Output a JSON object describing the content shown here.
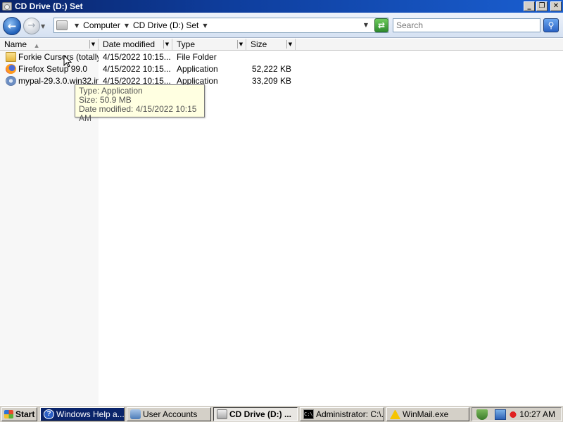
{
  "window": {
    "title": "CD Drive (D:) Set",
    "controls": {
      "minimize": "_",
      "restore": "❐",
      "close": "✕"
    }
  },
  "navigation": {
    "back_icon": "back-arrow-icon",
    "forward_icon": "forward-arrow-icon",
    "breadcrumb": [
      "Computer",
      "CD Drive (D:) Set"
    ],
    "search_placeholder": "Search"
  },
  "columns": [
    {
      "label": "Name",
      "sorted": true
    },
    {
      "label": "Date modified"
    },
    {
      "label": "Type"
    },
    {
      "label": "Size"
    }
  ],
  "files": [
    {
      "name": "Forkie Cursors (totally ...",
      "date": "4/15/2022 10:15...",
      "type": "File Folder",
      "size": "",
      "icon": "folder-icon"
    },
    {
      "name": "Firefox Setup 99.0",
      "date": "4/15/2022 10:15...",
      "type": "Application",
      "size": "52,222 KB",
      "icon": "firefox-icon"
    },
    {
      "name": "mypal-29.3.0.win32.in...",
      "date": "4/15/2022 10:15...",
      "type": "Application",
      "size": "33,209 KB",
      "icon": "installer-icon"
    }
  ],
  "tooltip": {
    "type_line": "Type: Application",
    "size_line": "Size: 50.9 MB",
    "date_line": "Date modified: 4/15/2022 10:15 AM"
  },
  "taskbar": {
    "start_label": "Start",
    "tasks": [
      {
        "label": "Windows Help a...",
        "icon": "help-icon",
        "state": "normal-dark"
      },
      {
        "label": "User Accounts",
        "icon": "users-icon",
        "state": "normal"
      },
      {
        "label": "CD Drive (D:) ...",
        "icon": "cd-drive-icon",
        "state": "active"
      },
      {
        "label": "Administrator: C:\\...",
        "icon": "command-prompt-icon",
        "state": "normal"
      },
      {
        "label": "WinMail.exe",
        "icon": "warning-icon",
        "state": "normal"
      }
    ],
    "clock": "10:27 AM"
  }
}
